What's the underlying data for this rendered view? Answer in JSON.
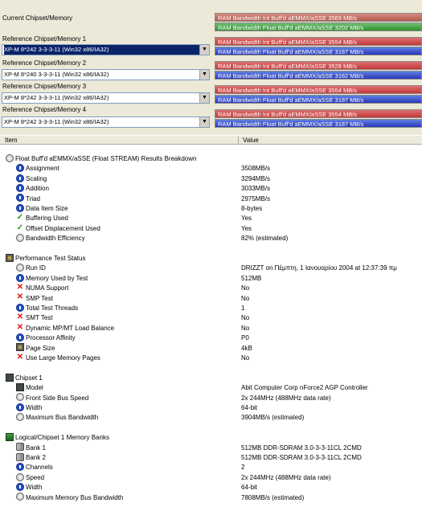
{
  "current": {
    "label": "Current Chipset/Memory",
    "bar_int": "RAM Bandwidth Int Buff'd aEMMX/aSSE 3569 MB/s",
    "bar_float": "RAM Bandwidth Float Buff'd aEMMX/aSSE 3202 MB/s"
  },
  "references": [
    {
      "label": "Reference Chipset/Memory 1",
      "combo_value": "XP-M 8*242  3-3-3-11 (Win32 x86/IA32)",
      "bar_int": "RAM Bandwidth Int Buff'd aEMMX/aSSE 3554 MB/s",
      "bar_float": "RAM Bandwidth Float Buff'd aEMMX/aSSE 3187 MB/s"
    },
    {
      "label": "Reference Chipset/Memory 2",
      "combo_value": "XP-M 8*240  3-3-3-11 (Win32 x86/IA32)",
      "bar_int": "RAM Bandwidth Int Buff'd aEMMX/aSSE 3528 MB/s",
      "bar_float": "RAM Bandwidth Float Buff'd aEMMX/aSSE 3162 MB/s"
    },
    {
      "label": "Reference Chipset/Memory 3",
      "combo_value": "XP-M 8*242  3-3-3-11 (Win32 x86/IA32)",
      "bar_int": "RAM Bandwidth Int Buff'd aEMMX/aSSE 3554 MB/s",
      "bar_float": "RAM Bandwidth Float Buff'd aEMMX/aSSE 3187 MB/s"
    },
    {
      "label": "Reference Chipset/Memory 4",
      "combo_value": "XP-M 8*242  3-3-3-11 (Win32 x86/IA32)",
      "bar_int": "RAM Bandwidth Int Buff'd aEMMX/aSSE 3554 MB/s",
      "bar_float": "RAM Bandwidth Float Buff'd aEMMX/aSSE 3187 MB/s"
    }
  ],
  "table": {
    "col_item": "Item",
    "col_value": "Value",
    "rows": [
      {
        "indent": 0,
        "icon": "gauge-icon",
        "item": "Float Buff'd aEMMX/aSSE (Float STREAM) Results Breakdown",
        "value": ""
      },
      {
        "indent": 1,
        "icon": "info-diamond-icon",
        "item": "Assignment",
        "value": "3508MB/s"
      },
      {
        "indent": 1,
        "icon": "info-diamond-icon",
        "item": "Scaling",
        "value": "3294MB/s"
      },
      {
        "indent": 1,
        "icon": "info-diamond-icon",
        "item": "Addition",
        "value": "3033MB/s"
      },
      {
        "indent": 1,
        "icon": "info-diamond-icon",
        "item": "Triad",
        "value": "2975MB/s"
      },
      {
        "indent": 1,
        "icon": "info-diamond-icon",
        "item": "Data Item Size",
        "value": "8-bytes"
      },
      {
        "indent": 1,
        "icon": "check-icon",
        "item": "Buffering Used",
        "value": "Yes"
      },
      {
        "indent": 1,
        "icon": "check-icon",
        "item": "Offset Displacement Used",
        "value": "Yes"
      },
      {
        "indent": 1,
        "icon": "gauge-icon",
        "item": "Bandwidth Efficiency",
        "value": "82% (estimated)"
      },
      {
        "indent": 0,
        "icon": "",
        "item": "",
        "value": ""
      },
      {
        "indent": 0,
        "icon": "cpu-icon",
        "item": "Performance Test Status",
        "value": ""
      },
      {
        "indent": 1,
        "icon": "gauge-icon",
        "item": "Run ID",
        "value": "DRIZZT on Πέμπτη, 1 Ιανουαρίου 2004 at 12:37:39 πμ"
      },
      {
        "indent": 1,
        "icon": "info-diamond-icon",
        "item": "Memory Used by Test",
        "value": "512MB"
      },
      {
        "indent": 1,
        "icon": "cross-icon",
        "item": "NUMA Support",
        "value": "No"
      },
      {
        "indent": 1,
        "icon": "cross-icon",
        "item": "SMP Test",
        "value": "No"
      },
      {
        "indent": 1,
        "icon": "info-diamond-icon",
        "item": "Total Test Threads",
        "value": "1"
      },
      {
        "indent": 1,
        "icon": "cross-icon",
        "item": "SMT Test",
        "value": "No"
      },
      {
        "indent": 1,
        "icon": "cross-icon",
        "item": "Dynamic MP/MT Load Balance",
        "value": "No"
      },
      {
        "indent": 1,
        "icon": "info-diamond-icon",
        "item": "Processor Affinity",
        "value": "P0"
      },
      {
        "indent": 1,
        "icon": "cpu-icon",
        "item": "Page Size",
        "value": "4kB"
      },
      {
        "indent": 1,
        "icon": "cross-icon",
        "item": "Use Large Memory Pages",
        "value": "No"
      },
      {
        "indent": 0,
        "icon": "",
        "item": "",
        "value": ""
      },
      {
        "indent": 0,
        "icon": "chip-icon",
        "item": "Chipset 1",
        "value": ""
      },
      {
        "indent": 1,
        "icon": "chip-icon",
        "item": "Model",
        "value": "Abit Computer Corp nForce2 AGP Controller"
      },
      {
        "indent": 1,
        "icon": "gauge-icon",
        "item": "Front Side Bus Speed",
        "value": "2x 244MHz (488MHz data rate)"
      },
      {
        "indent": 1,
        "icon": "info-diamond-icon",
        "item": "Width",
        "value": "64-bit"
      },
      {
        "indent": 1,
        "icon": "gauge-icon",
        "item": "Maximum Bus Bandwidth",
        "value": "3904MB/s (estimated)"
      },
      {
        "indent": 0,
        "icon": "",
        "item": "",
        "value": ""
      },
      {
        "indent": 0,
        "icon": "memory-icon",
        "item": "Logical/Chipset 1 Memory Banks",
        "value": ""
      },
      {
        "indent": 1,
        "icon": "bus-icon",
        "item": "Bank 1",
        "value": "512MB DDR-SDRAM 3.0-3-3-11CL 2CMD"
      },
      {
        "indent": 1,
        "icon": "bus-icon",
        "item": "Bank 2",
        "value": "512MB DDR-SDRAM 3.0-3-3-11CL 2CMD"
      },
      {
        "indent": 1,
        "icon": "info-diamond-icon",
        "item": "Channels",
        "value": "2"
      },
      {
        "indent": 1,
        "icon": "gauge-icon",
        "item": "Speed",
        "value": "2x 244MHz (488MHz data rate)"
      },
      {
        "indent": 1,
        "icon": "info-diamond-icon",
        "item": "Width",
        "value": "64-bit"
      },
      {
        "indent": 1,
        "icon": "gauge-icon",
        "item": "Maximum Memory Bus Bandwidth",
        "value": "7808MB/s (estimated)"
      }
    ]
  }
}
